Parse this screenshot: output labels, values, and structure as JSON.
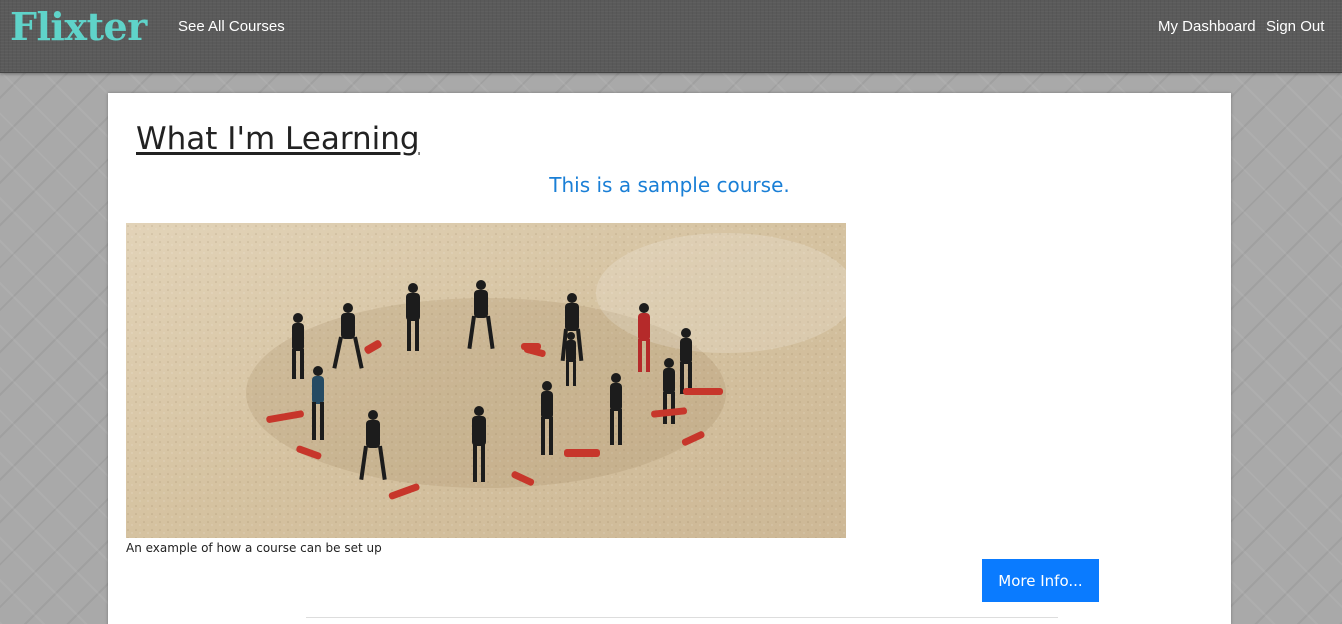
{
  "navbar": {
    "brand": "Flixter",
    "see_all_courses": "See All Courses",
    "my_dashboard": "My Dashboard",
    "sign_out": "Sign Out"
  },
  "main": {
    "page_title": "What I'm Learning",
    "course": {
      "title": "This is a sample course.",
      "image_description": "group in wetsuits standing in a circle on sand",
      "caption": "An example of how a course can be set up",
      "more_info_label": "More Info..."
    }
  },
  "colors": {
    "brand": "#5fd3c9",
    "course_title": "#1a7fd6",
    "button": "#0a7bff",
    "navbar": "#5a5a5a"
  }
}
